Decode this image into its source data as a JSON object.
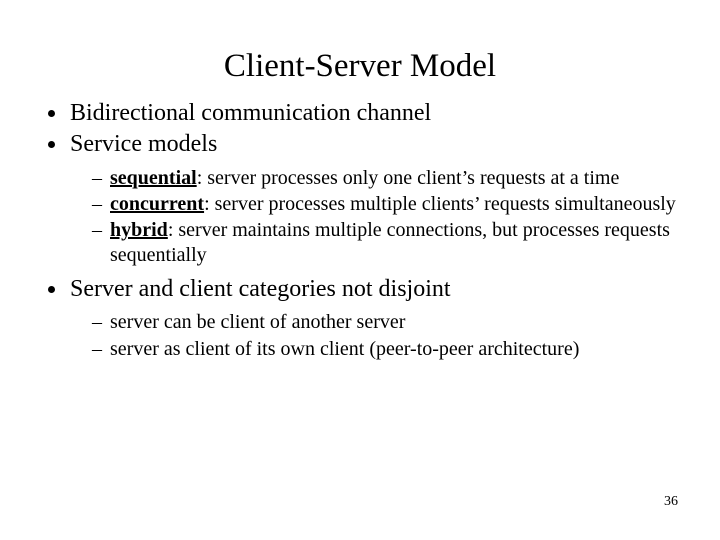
{
  "title": "Client-Server Model",
  "bullets": {
    "b1": "Bidirectional communication channel",
    "b2": "Service models",
    "b2_sub": {
      "s1_term": "sequential",
      "s1_rest": ": server processes only one client’s requests at a time",
      "s2_term": "concurrent",
      "s2_rest": ": server processes multiple clients’ requests simultaneously",
      "s3_term": "hybrid",
      "s3_rest": ": server maintains multiple connections, but processes requests sequentially"
    },
    "b3": "Server and client categories not disjoint",
    "b3_sub": {
      "s1": "server can be client of another server",
      "s2": "server as client of its own client (peer-to-peer architecture)"
    }
  },
  "page_number": "36"
}
